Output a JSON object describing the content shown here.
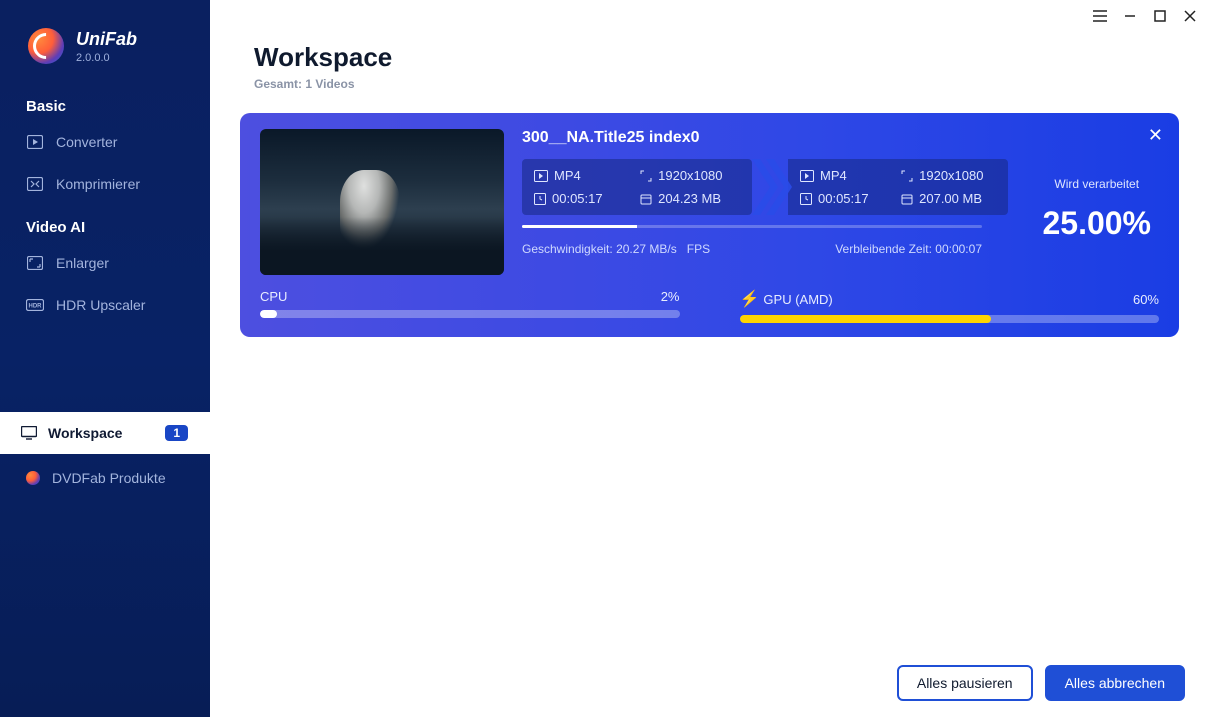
{
  "app": {
    "name": "UniFab",
    "version": "2.0.0.0"
  },
  "sidebar": {
    "sections": {
      "basic_label": "Basic",
      "video_ai_label": "Video AI"
    },
    "items": {
      "converter": "Converter",
      "komprimierer": "Komprimierer",
      "enlarger": "Enlarger",
      "hdr": "HDR Upscaler"
    },
    "workspace": {
      "label": "Workspace",
      "badge": "1"
    },
    "dvdfab": "DVDFab Produkte"
  },
  "header": {
    "title": "Workspace",
    "subtitle": "Gesamt: 1 Videos"
  },
  "task": {
    "title": "300__NA.Title25 index0",
    "src": {
      "format": "MP4",
      "resolution": "1920x1080",
      "duration": "00:05:17",
      "size": "204.23 MB"
    },
    "dst": {
      "format": "MP4",
      "resolution": "1920x1080",
      "duration": "00:05:17",
      "size": "207.00 MB"
    },
    "speed_label": "Geschwindigkeit:",
    "speed_value": "20.27 MB/s",
    "fps_label": "FPS",
    "remaining_label": "Verbleibende Zeit:",
    "remaining_value": "00:00:07",
    "status_label": "Wird verarbeitet",
    "percent": "25.00%",
    "progress_pct": 25,
    "cpu": {
      "label": "CPU",
      "pct": "2%",
      "val": 2
    },
    "gpu": {
      "label": "GPU (AMD)",
      "pct": "60%",
      "val": 60
    }
  },
  "footer": {
    "pause": "Alles pausieren",
    "cancel": "Alles abbrechen"
  }
}
